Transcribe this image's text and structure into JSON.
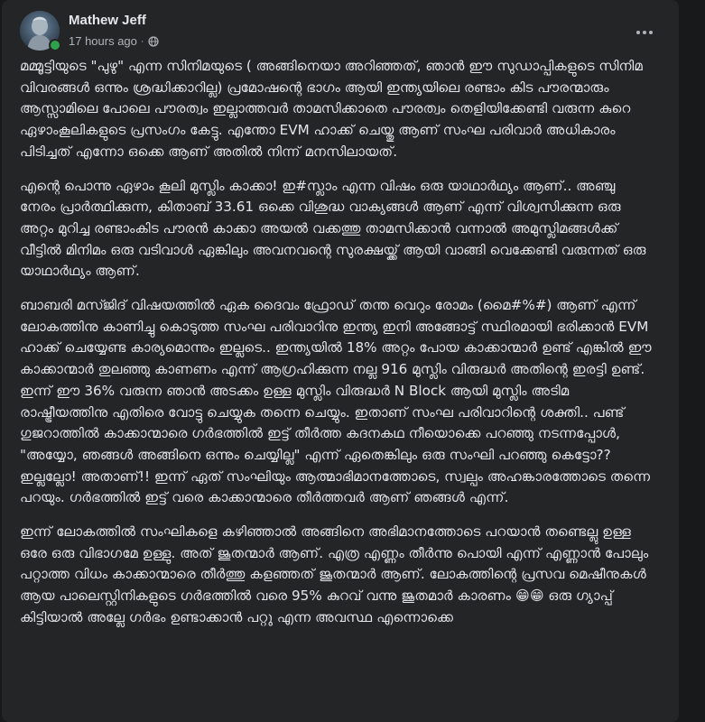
{
  "post": {
    "author": "Mathew Jeff",
    "timestamp": "17 hours ago",
    "separator": "·",
    "audience_icon": "globe-icon",
    "more_icon": "more-horizontal-icon",
    "online_status_color": "#31a24c",
    "paragraphs": [
      "മമ്മൂട്ടിയുടെ \"പുഴു\" എന്ന സിനിമയുടെ ( അങ്ങിനെയാ അറിഞ്ഞത്, ഞാൻ ഈ സുഡാപ്പികളുടെ സിനിമ വിവരങ്ങൾ ഒന്നും ശ്രദ്ധിക്കാറില്ല) പ്രമോഷന്റെ ഭാഗം ആയി ഇന്ത്യയിലെ രണ്ടാം കിട പൗരന്മാരും ആസ്സാമിലെ പോലെ പൗരത്വം ഇല്ലാത്തവർ താമസിക്കാതെ പൗരത്വം തെളിയിക്കേണ്ടി വരുന്ന കുറെ ഏഴാംകൂലികളുടെ പ്രസംഗം കേട്ടു. എന്തോ EVM ഹാക്ക് ചെയ്തു ആണ് സംഘ പരിവാർ അധികാരം പിടിച്ചത് എന്നോ ഒക്കെ ആണ് അതിൽ നിന്ന് മനസിലായത്.",
      "എന്റെ പൊന്നു ഏഴാം കൂലി മുസ്ലിം കാക്കാ! ഇ#സ്ലാം എന്ന വിഷം ഒരു യാഥാർഥ്യം ആണ്.. അഞ്ചു നേരം പ്രാർത്ഥിക്കുന്ന, കിതാബ് 33.61 ഒക്കെ വിശുദ്ധ വാക്യങ്ങൾ ആണ് എന്ന് വിശ്വസിക്കുന്ന ഒരു അറ്റം മുറിച്ച രണ്ടാംകിട പൗരൻ കാക്കാ അയൽ വക്കത്തു താമസിക്കാൻ വന്നാൽ അമുസ്ലിമങ്ങൾക്ക് വീട്ടിൽ മിനിമം ഒരു വടിവാൾ ഏങ്കിലും അവനവന്റെ സുരക്ഷയ്ക്ക് ആയി വാങ്ങി വെക്കേണ്ടി വരുന്നത് ഒരു യാഥാർഥ്യം ആണ്.",
      "ബാബരി മസ്ജിദ് വിഷയത്തിൽ ഏക ദൈവം ഫ്രോഡ് തന്ത വെറും രോമം (മൈ#%#) ആണ് എന്ന് ലോകത്തിനു കാണിച്ചു കൊടുത്ത സംഘ പരിവാറിനു ഇന്ത്യ ഇനി അങ്ങോട്ട് സ്ഥിരമായി ഭരിക്കാൻ EVM ഹാക്ക് ചെയ്യേണ്ട കാര്യമൊന്നും ഇല്ലടെ.. ഇന്ത്യയിൽ 18% അറ്റം പോയ കാക്കാന്മാർ ഉണ്ട് എങ്കിൽ ഈ കാക്കാന്മാർ തുലഞ്ഞു കാണണം എന്ന് ആഗ്രഹിക്കുന്ന നല്ല 916 മുസ്ലിം വിരുദ്ധർ അതിന്റെ ഇരട്ടി ഉണ്ട്. ഇന്ന് ഈ 36% വരുന്ന ഞാൻ അടക്കം ഉള്ള മുസ്ലിം വിരുദ്ധർ N Block ആയി മുസ്ലിം അടിമ രാഷ്ട്രീയത്തിനു എതിരെ വോട്ടു ചെയ്യുക തന്നെ ചെയ്യും. ഇതാണ് സംഘ പരിവാറിന്റെ ശക്തി.. പണ്ട് ഗുജറാത്തിൽ കാക്കാന്മാരെ ഗർഭത്തിൽ ഇട്ട് തീർത്ത കദനകഥ നീയൊക്കെ പറഞ്ഞു നടന്നപ്പോൾ, \"അയ്യോ, ഞങ്ങൾ അങ്ങിനെ ഒന്നും ചെയ്യില്ല\" എന്ന് ഏതെങ്കിലും ഒരു സംഘി പറഞ്ഞു കെട്ടോ?? ഇല്ലല്ലോ! അതാണ്!! ഇന്ന് ഏത് സംഘിയും ആത്മാഭിമാനത്തോടെ, സ്വല്പം അഹങ്കാരത്തോടെ തന്നെ പറയും. ഗർഭത്തിൽ ഇട്ട് വരെ കാക്കാന്മാരെ തീർത്തവർ ആണ് ഞങ്ങൾ എന്ന്.",
      "ഇന്ന് ലോകത്തിൽ സംഘികളെ കഴിഞ്ഞാൽ അങ്ങിനെ അഭിമാനത്തോടെ പറയാൻ തണ്ടെല്ലു ഉള്ള ഒരേ ഒരു വിഭാഗമേ ഉള്ളു. അത് ജൂതന്മാർ ആണ്. എത്ര എണ്ണം തീർന്നു പൊയി എന്ന് എണ്ണാൻ പോലും പറ്റാത്ത വിധം കാക്കാന്മാരെ തീർത്തു കളഞ്ഞത് ജൂതന്മാർ ആണ്. ലോകത്തിന്റെ പ്രസവ മെഷീനുകൾ ആയ പാലെസ്റ്റിനികളുടെ ഗർഭത്തിൽ വരെ 95% കുറവ് വന്നു ജൂതമാർ കാരണം 😁😁 ഒരു ഗ്യാപ്പ് കിട്ടിയാൽ അല്ലേ ഗർഭം ഉണ്ടാക്കാൻ പറ്റു എന്ന അവസ്ഥ എന്നൊക്കെ"
    ]
  }
}
